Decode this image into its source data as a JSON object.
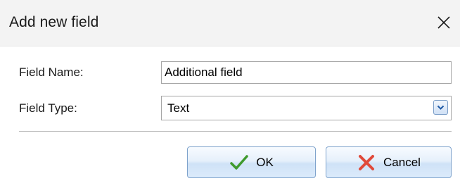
{
  "window": {
    "title": "Add new field"
  },
  "form": {
    "field_name_label": "Field Name:",
    "field_name_value": "Additional field",
    "field_type_label": "Field Type:",
    "field_type_value": "Text"
  },
  "buttons": {
    "ok_label": "OK",
    "cancel_label": "Cancel"
  },
  "icons": {
    "close": "close-icon",
    "dropdown": "chevron-down-icon",
    "ok": "checkmark-icon",
    "cancel": "red-x-icon"
  },
  "colors": {
    "checkmark": "#3f9a2e",
    "cancel_x": "#e04a3a",
    "dropdown_arrow": "#1f5aa6"
  }
}
